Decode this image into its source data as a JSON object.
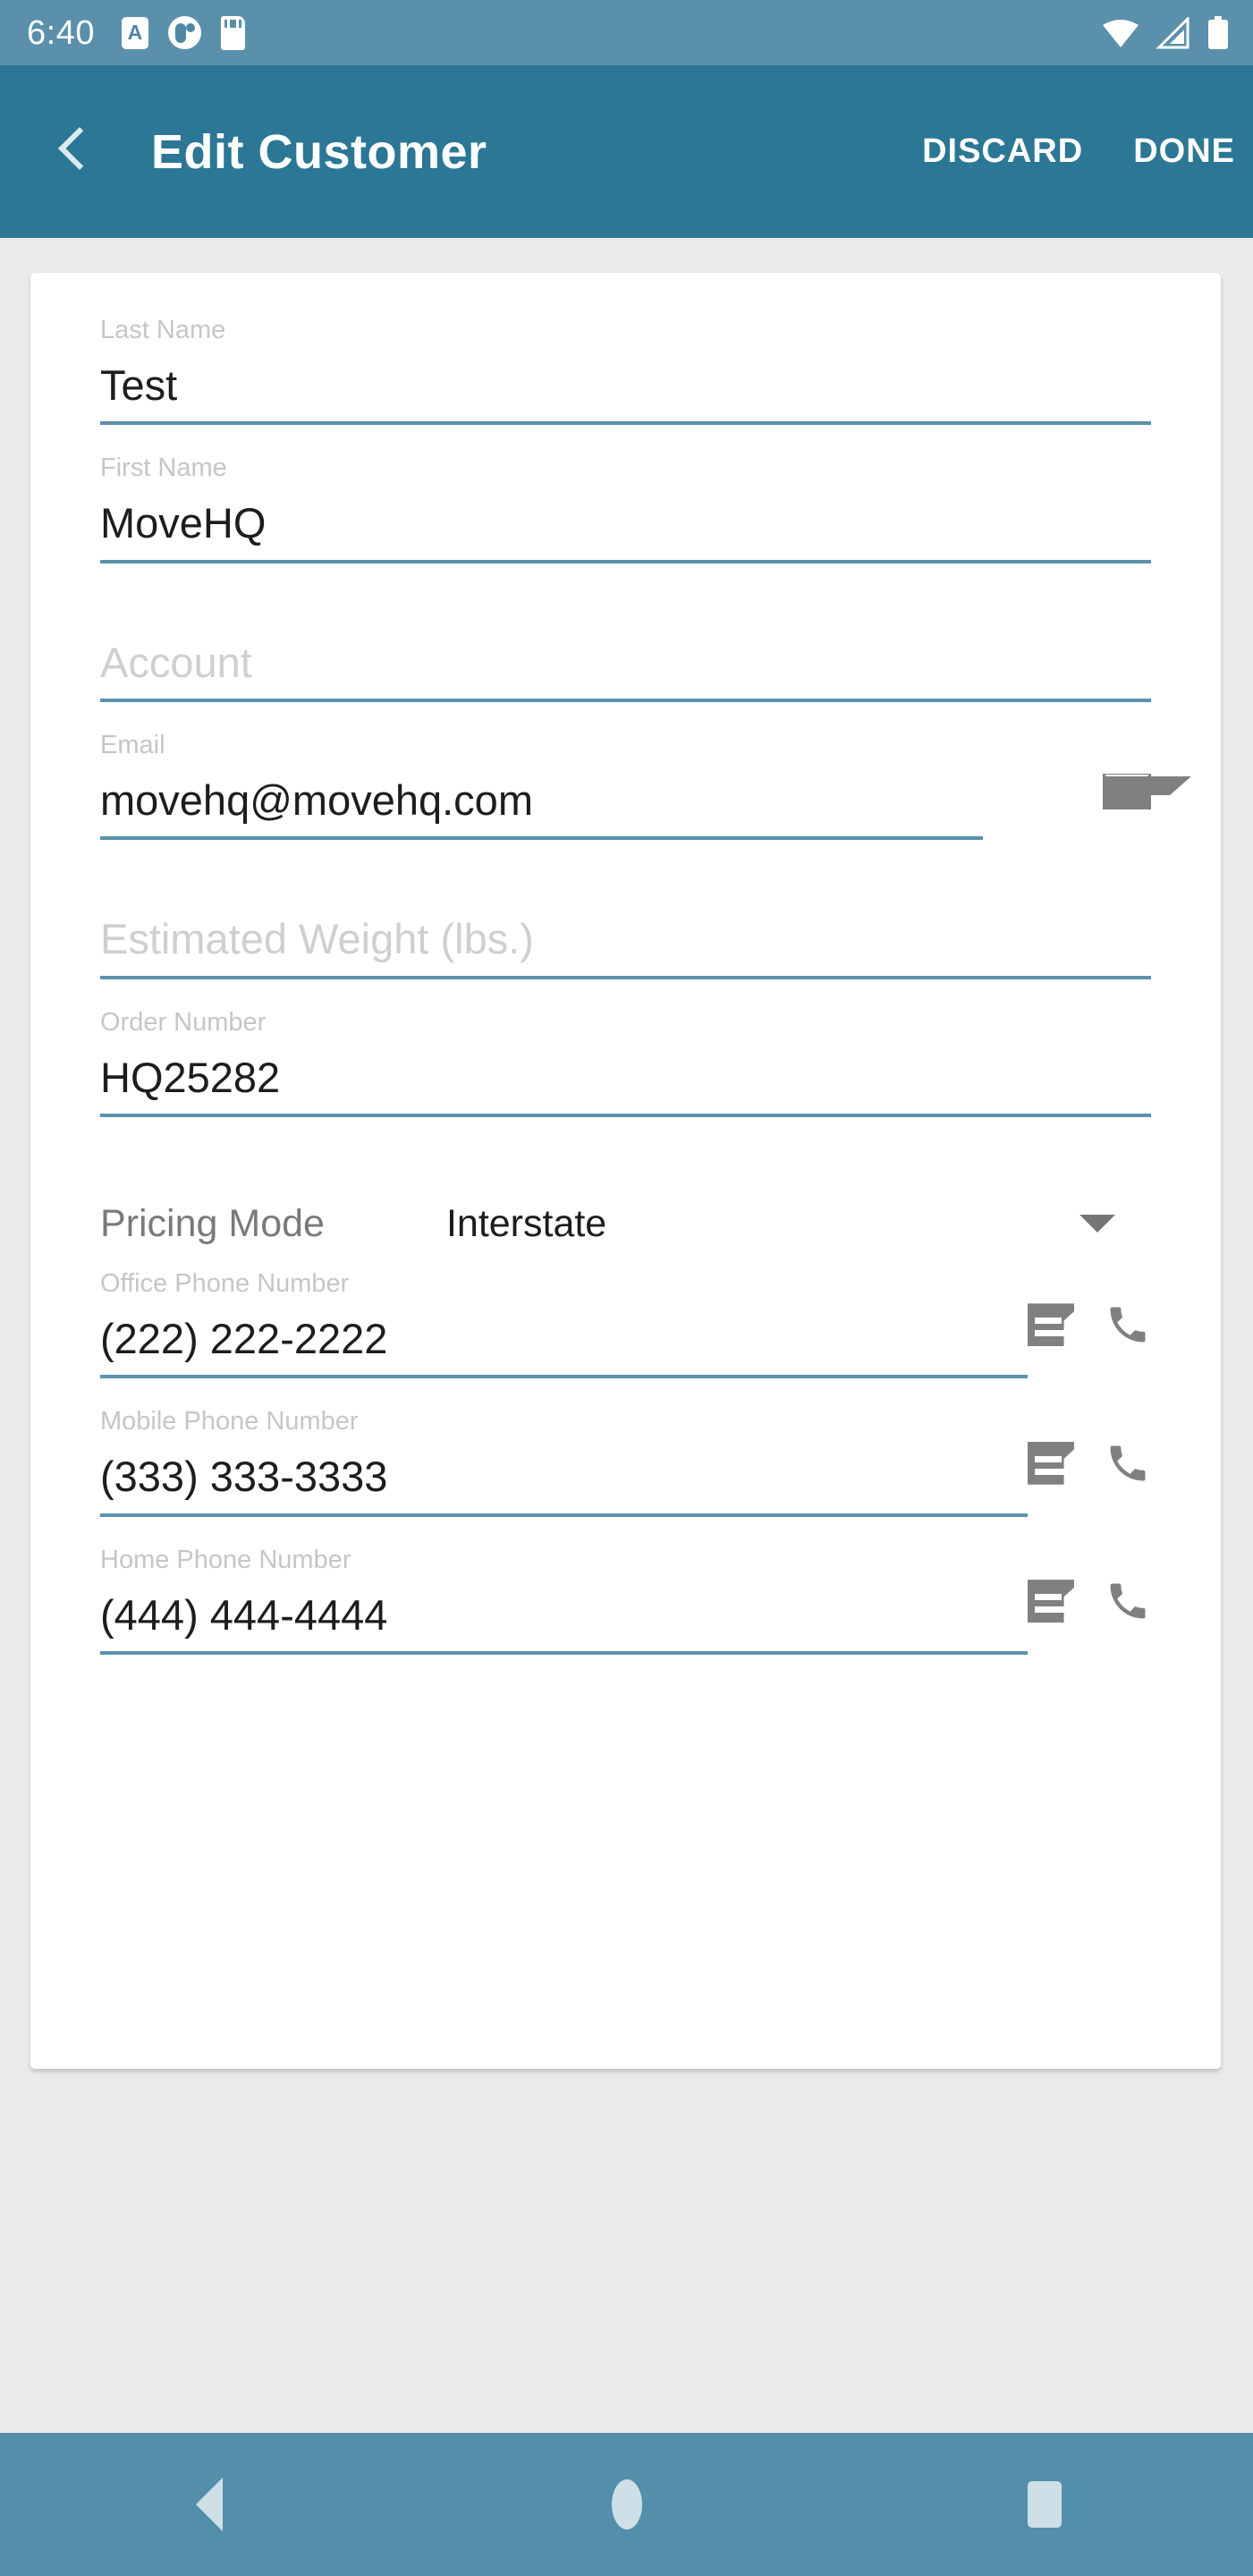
{
  "status_bar": {
    "clock": "6:40",
    "left_icons": [
      "a-badge-icon",
      "circle-app-icon",
      "sdcard-icon"
    ],
    "right_icons": [
      "wifi-icon",
      "cell-signal-icon",
      "battery-icon"
    ],
    "background_color": "#5a90ab"
  },
  "app_bar": {
    "back_label": "back-chevron-icon",
    "title": "Edit Customer",
    "discard_label": "DISCARD",
    "done_label": "DONE",
    "background_color": "#2b7795"
  },
  "form": {
    "accent_underline_color": "#5b92ad",
    "fields": [
      {
        "label": "Last Name",
        "value": "Test",
        "placeholder": "Last Name"
      },
      {
        "label": "First Name",
        "value": "MoveHQ",
        "placeholder": "First Name"
      },
      {
        "label": "",
        "value": "",
        "placeholder": "Account"
      },
      {
        "label": "Email",
        "value": "movehq@movehq.com",
        "placeholder": "Email"
      },
      {
        "label": "",
        "value": "",
        "placeholder": "Estimated Weight (lbs.)"
      },
      {
        "label": "Order Number",
        "value": "HQ25282",
        "placeholder": "Order Number"
      }
    ],
    "pricing_mode": {
      "label": "Pricing Mode",
      "value": "Interstate"
    },
    "phones": [
      {
        "label": "Office Phone Number",
        "value": "(222) 222-2222"
      },
      {
        "label": "Mobile Phone Number",
        "value": "(333) 333-3333"
      },
      {
        "label": "Home Phone Number",
        "value": "(444) 444-4444"
      }
    ]
  },
  "nav_bar": {
    "back": "nav-back-icon",
    "home": "nav-home-icon",
    "recents": "nav-recents-icon",
    "background_color": "#538fab"
  }
}
